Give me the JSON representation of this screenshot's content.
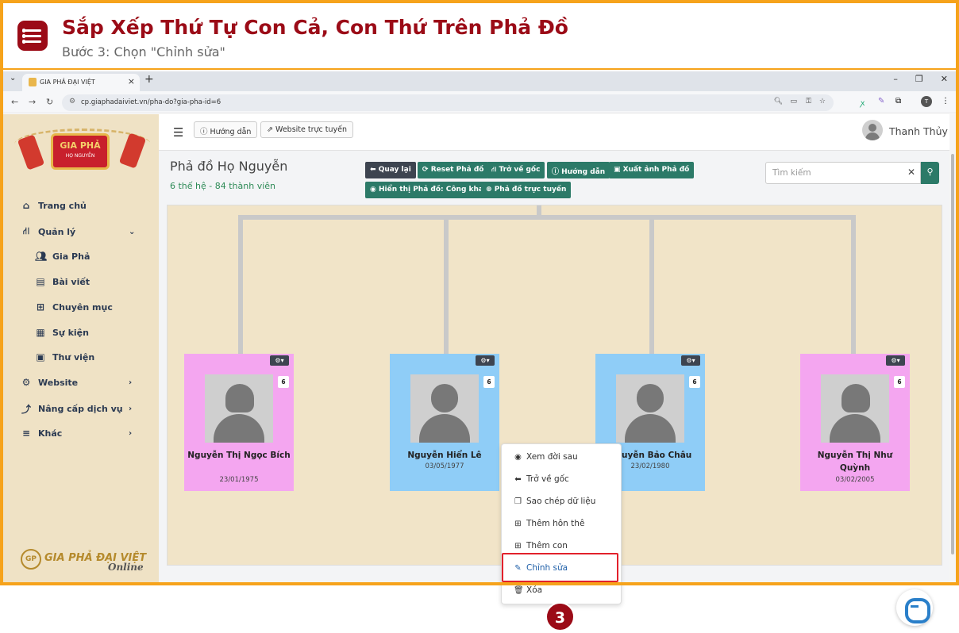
{
  "header": {
    "title": "Sắp Xếp Thứ Tự Con Cả, Con Thứ Trên Phả Đồ",
    "subtitle": "Bước 3: Chọn \"Chỉnh sửa\""
  },
  "browser": {
    "tab_title": "GIA PHẢ ĐẠI VIỆT",
    "url": "cp.giaphadaiviet.vn/pha-do?gia-pha-id=6",
    "profile_initial": "T"
  },
  "sidebar": {
    "logo_title": "GIA PHẢ",
    "logo_sub": "HỌ NGUYỄN",
    "items": [
      {
        "label": "Trang chủ",
        "icon": "home-icon"
      },
      {
        "label": "Quản lý",
        "icon": "sitemap-icon"
      },
      {
        "label": "Gia Phả",
        "icon": "users-icon"
      },
      {
        "label": "Bài viết",
        "icon": "newspaper-icon"
      },
      {
        "label": "Chuyên mục",
        "icon": "grid-icon"
      },
      {
        "label": "Sự kiện",
        "icon": "calendar-icon"
      },
      {
        "label": "Thư viện",
        "icon": "images-icon"
      },
      {
        "label": "Website",
        "icon": "gear-icon"
      },
      {
        "label": "Nâng cấp dịch vụ",
        "icon": "upgrade-icon"
      },
      {
        "label": "Khác",
        "icon": "bars-icon"
      }
    ],
    "footer_logo": "GIA PHẢ ĐẠI VIỆT",
    "footer_logo_gp": "GP",
    "footer_logo_script": "Online"
  },
  "topnav": {
    "guide_label": "Hướng dẫn",
    "website_label": "Website trực tuyến",
    "user_name": "Thanh Thủy"
  },
  "page": {
    "title": "Phả đồ Họ Nguyễn",
    "stats": "6 thế hệ - 84 thành viên",
    "buttons": [
      "Quay lại",
      "Reset Phả đồ",
      "Trở về gốc",
      "Hướng dẫn",
      "Xuất ảnh Phả đồ",
      "Hiển thị Phả đồ: Công khai",
      "Phả đồ trực tuyến"
    ],
    "search_placeholder": "Tìm kiếm"
  },
  "members": [
    {
      "name": "Nguyễn Thị Ngọc Bích",
      "date": "23/01/1975",
      "gender": "female",
      "badge": "6"
    },
    {
      "name": "Nguyễn Hiển Lê",
      "date": "03/05/1977",
      "gender": "male",
      "badge": "6"
    },
    {
      "name": "Nguyễn Bảo Châu",
      "date": "23/02/1980",
      "gender": "male",
      "badge": "6"
    },
    {
      "name": "Nguyễn Thị Như Quỳnh",
      "date": "03/02/2005",
      "gender": "female",
      "badge": "6"
    }
  ],
  "context_menu": [
    "Xem đời sau",
    "Trở về gốc",
    "Sao chép dữ liệu",
    "Thêm hôn thê",
    "Thêm con",
    "Chỉnh sửa",
    "Xóa"
  ],
  "step_number": "3",
  "colors": {
    "accent": "#9b0b17",
    "frame": "#f6a31b",
    "primary_green": "#2c7a68",
    "female_card": "#f4a6f0",
    "male_card": "#8fcdf7"
  }
}
